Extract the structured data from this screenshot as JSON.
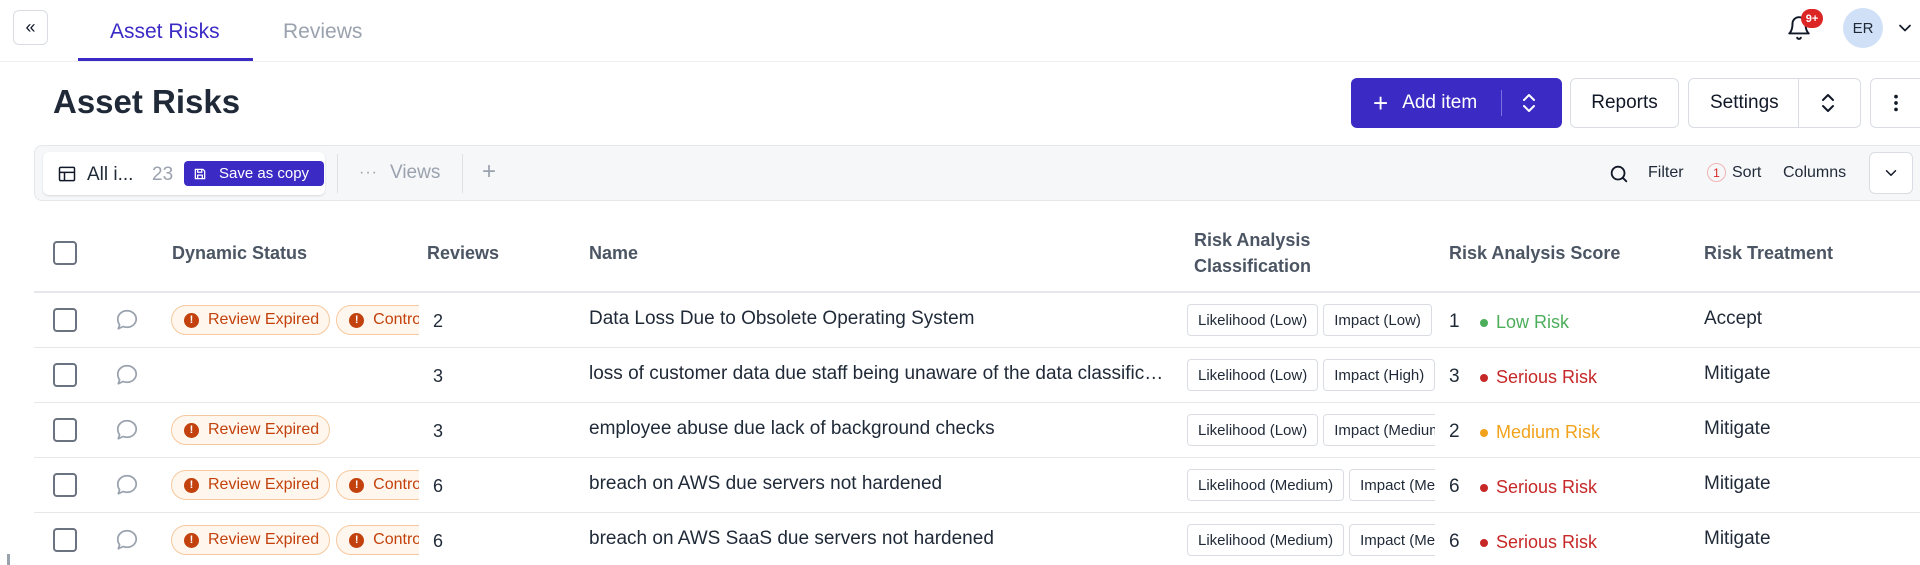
{
  "tabs": [
    {
      "label": "Asset Risks",
      "active": true
    },
    {
      "label": "Reviews",
      "active": false
    }
  ],
  "notifications": {
    "badge": "9+"
  },
  "user": {
    "initials": "ER"
  },
  "page": {
    "title": "Asset Risks"
  },
  "actions": {
    "add_item": "Add item",
    "reports": "Reports",
    "settings": "Settings"
  },
  "view": {
    "name": "All i...",
    "count": "23",
    "save_as_copy": "Save as copy",
    "views_label": "Views"
  },
  "toolbar": {
    "filter": "Filter",
    "sort_count": "1",
    "sort": "Sort",
    "columns": "Columns"
  },
  "table": {
    "headers": {
      "dynamic_status": "Dynamic Status",
      "reviews": "Reviews",
      "name": "Name",
      "classification_line1": "Risk Analysis",
      "classification_line2": "Classification",
      "score": "Risk Analysis Score",
      "treatment": "Risk Treatment"
    },
    "rows": [
      {
        "statuses": [
          "Review Expired",
          "Controls"
        ],
        "reviews": "2",
        "name": "Data Loss Due to Obsolete Operating System",
        "likelihood": "Likelihood (Low)",
        "impact": "Impact (Low)",
        "score": "1",
        "risk_label": "Low Risk",
        "risk_color": "#4cae5b",
        "treatment": "Accept"
      },
      {
        "statuses": [],
        "reviews": "3",
        "name": "loss of customer data due staff being unaware of the data classification",
        "likelihood": "Likelihood (Low)",
        "impact": "Impact (High)",
        "score": "3",
        "risk_label": "Serious Risk",
        "risk_color": "#c62828",
        "treatment": "Mitigate"
      },
      {
        "statuses": [
          "Review Expired"
        ],
        "reviews": "3",
        "name": "employee abuse due lack of background checks",
        "likelihood": "Likelihood (Low)",
        "impact": "Impact (Medium)",
        "score": "2",
        "risk_label": "Medium Risk",
        "risk_color": "#f2a21a",
        "treatment": "Mitigate"
      },
      {
        "statuses": [
          "Review Expired",
          "Controls"
        ],
        "reviews": "6",
        "name": "breach on AWS due servers not hardened",
        "likelihood": "Likelihood (Medium)",
        "impact": "Impact (Medium)",
        "score": "6",
        "risk_label": "Serious Risk",
        "risk_color": "#c62828",
        "treatment": "Mitigate"
      },
      {
        "statuses": [
          "Review Expired",
          "Controls"
        ],
        "reviews": "6",
        "name": "breach on AWS SaaS due servers not hardened",
        "likelihood": "Likelihood (Medium)",
        "impact": "Impact (Medium)",
        "score": "6",
        "risk_label": "Serious Risk",
        "risk_color": "#c62828",
        "treatment": "Mitigate"
      }
    ]
  }
}
